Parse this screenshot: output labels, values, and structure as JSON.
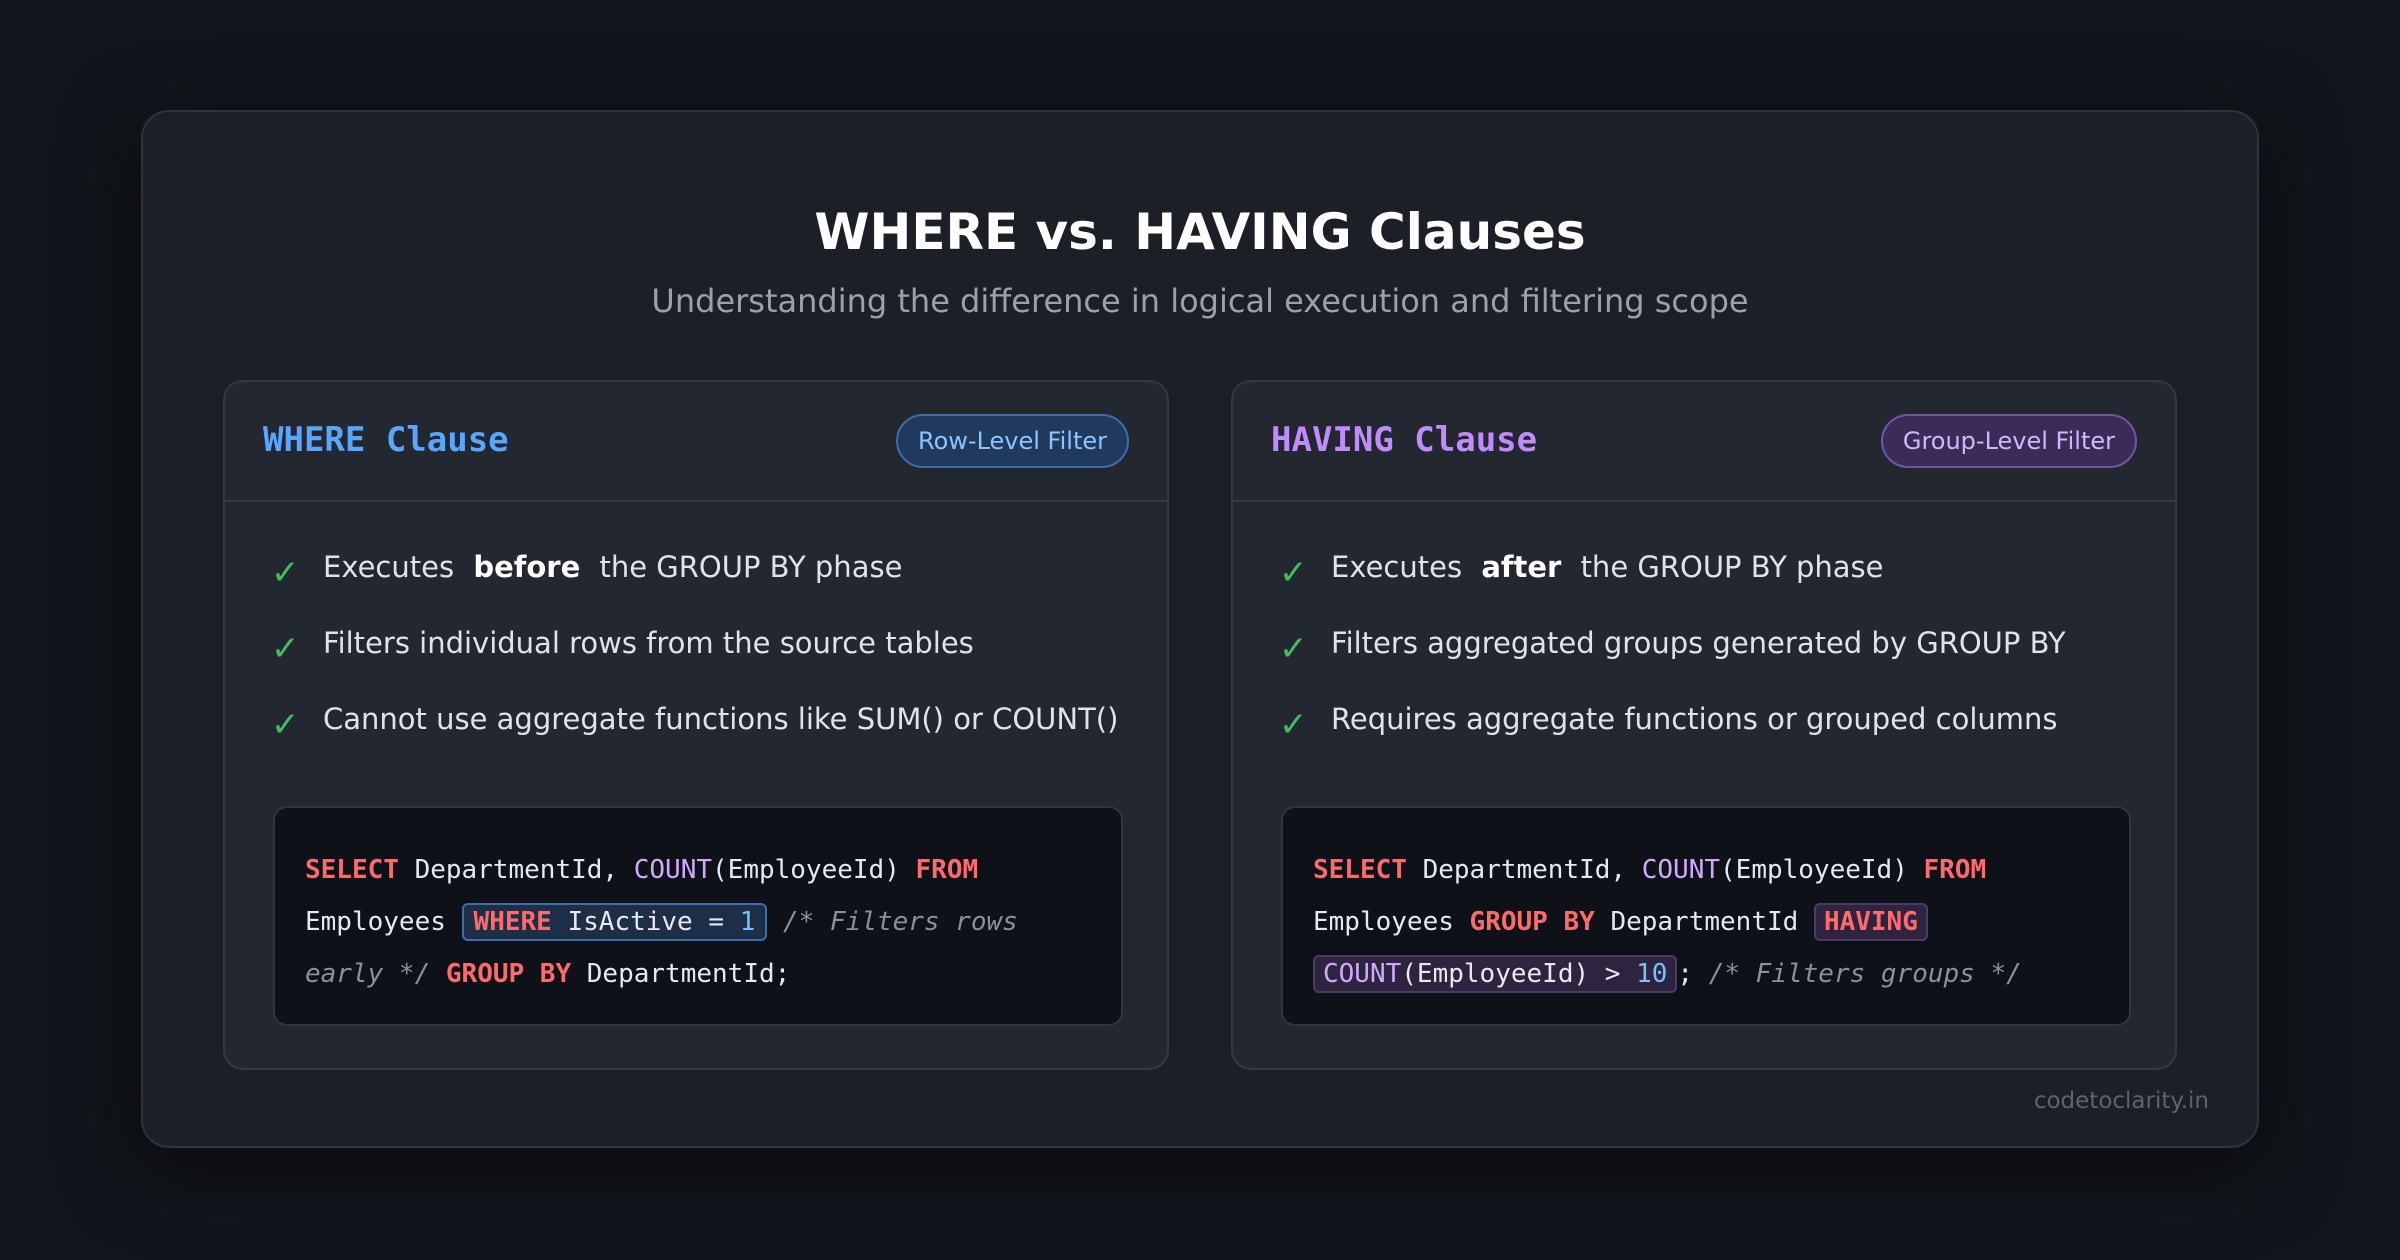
{
  "header": {
    "title": "WHERE vs. HAVING Clauses",
    "subtitle": "Understanding the difference in logical execution and filtering scope"
  },
  "colors": {
    "background": "#12151b",
    "card": "#1c1f26",
    "where_accent": "#58a6ff",
    "having_accent": "#c08bff",
    "check": "#3fbf5a",
    "keyword": "#ff6b6b"
  },
  "where_panel": {
    "title": "WHERE Clause",
    "badge": "Row-Level Filter",
    "point1": {
      "pre": "Executes",
      "emph": "before",
      "post": "the GROUP BY phase"
    },
    "point2": "Filters individual rows from the source tables",
    "point3": "Cannot use aggregate functions like SUM() or COUNT()",
    "code": {
      "select": "SELECT",
      "col": "DepartmentId,",
      "count": "COUNT",
      "arg": "(EmployeeId)",
      "from": "FROM",
      "table": "Employees",
      "where": "WHERE",
      "cond": "IsActive =",
      "num": "1",
      "comment_a": "/* Filters rows",
      "comment_b": "early */",
      "group": "GROUP BY",
      "group_col": "DepartmentId;"
    }
  },
  "having_panel": {
    "title": "HAVING Clause",
    "badge": "Group-Level Filter",
    "point1": {
      "pre": "Executes",
      "emph": "after",
      "post": "the GROUP BY phase"
    },
    "point2": "Filters aggregated groups generated by GROUP BY",
    "point3": "Requires aggregate functions or grouped columns",
    "code": {
      "select": "SELECT",
      "col": "DepartmentId,",
      "count": "COUNT",
      "arg": "(EmployeeId)",
      "from": "FROM",
      "table": "Employees",
      "group": "GROUP BY",
      "group_col": "DepartmentId",
      "having": "HAVING",
      "count2": "COUNT",
      "arg2": "(EmployeeId) >",
      "num": "10",
      "semi": ";",
      "comment": "/* Filters groups */"
    }
  },
  "footer": {
    "credit": "codetoclarity.in"
  }
}
